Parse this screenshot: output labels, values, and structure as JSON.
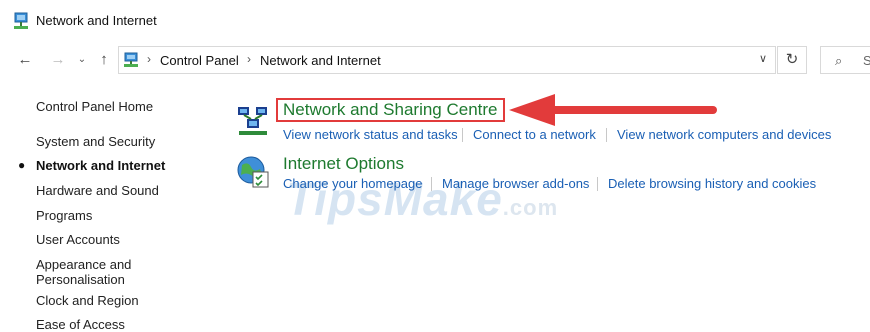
{
  "window": {
    "title": "Network and Internet"
  },
  "nav": {
    "back": "←",
    "forward": "→",
    "recent": "⌄",
    "up": "↑",
    "refresh": "↻"
  },
  "address": {
    "crumbs": [
      "Control Panel",
      "Network and Internet"
    ]
  },
  "search": {
    "placeholder": "S"
  },
  "sidebar": {
    "items": [
      {
        "label": "Control Panel Home"
      },
      {
        "label": "System and Security"
      },
      {
        "label": "Network and Internet",
        "active": true
      },
      {
        "label": "Hardware and Sound"
      },
      {
        "label": "Programs"
      },
      {
        "label": "User Accounts"
      },
      {
        "label": "Appearance and\nPersonalisation"
      },
      {
        "label": "Clock and Region"
      },
      {
        "label": "Ease of Access"
      }
    ]
  },
  "categories": [
    {
      "title": "Network and Sharing Centre",
      "tasks": [
        "View network status and tasks",
        "Connect to a network",
        "View network computers and devices"
      ]
    },
    {
      "title": "Internet Options",
      "tasks": [
        "Change your homepage",
        "Manage browser add-ons",
        "Delete browsing history and cookies"
      ]
    }
  ],
  "watermark": {
    "text": "TipsMake",
    "suffix": ".com"
  },
  "colors": {
    "link": "#1a5fb4",
    "category": "#1e7a2f",
    "annotation": "#e23b3b"
  }
}
